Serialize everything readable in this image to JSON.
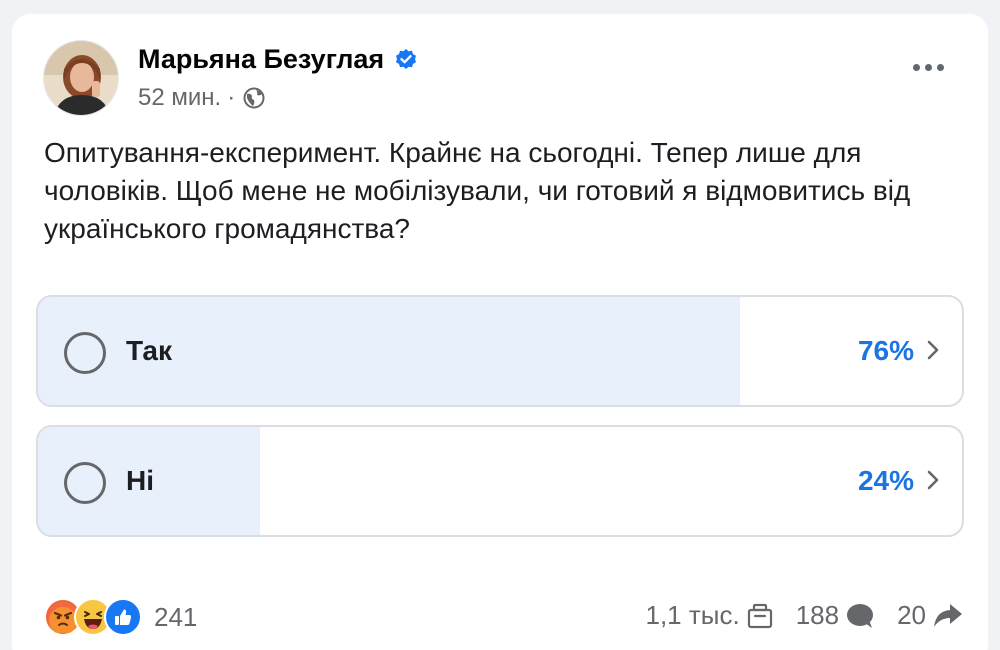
{
  "post": {
    "author": "Марьяна Безуглая",
    "time": "52 мин.",
    "separator": "·",
    "text": "Опитування-експеримент. Крайнє на сьогодні. Тепер лише для чоловіків. Щоб мене не мобілізували, чи готовий я відмовитись від українського громадянства?"
  },
  "poll": {
    "options": [
      {
        "label": "Так",
        "percent": "76%",
        "share": 0.76
      },
      {
        "label": "Ні",
        "percent": "24%",
        "share": 0.24
      }
    ]
  },
  "footer": {
    "reactions": [
      "angry-icon",
      "haha-icon",
      "like-icon"
    ],
    "reactions_count": "241",
    "saves_count": "1,1 тыс.",
    "comments_count": "188",
    "shares_count": "20"
  },
  "colors": {
    "accent": "#1b74e4",
    "poll_fill": "#e8f0fb",
    "verified": "#1877f2"
  }
}
